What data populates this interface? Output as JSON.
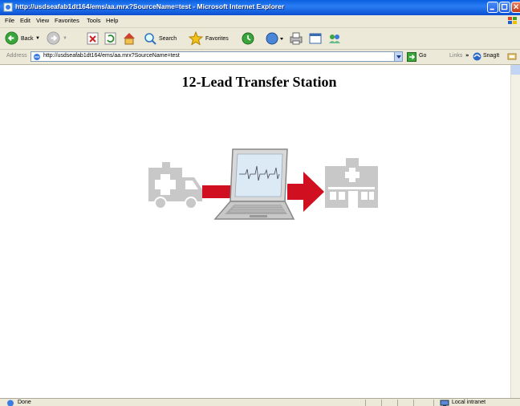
{
  "window": {
    "title": "http://usdseafab1dt164/ems/aa.mrx?SourceName=test - Microsoft Internet Explorer"
  },
  "menu": {
    "items": [
      "File",
      "Edit",
      "View",
      "Favorites",
      "Tools",
      "Help"
    ]
  },
  "toolbar": {
    "back_label": "Back",
    "search_label": "Search",
    "favorites_label": "Favorites"
  },
  "address": {
    "label": "Address",
    "url": "http://usdseafab1dt164/ems/aa.mrx?SourceName=test",
    "go_label": "Go",
    "links_label": "Links",
    "chevron": "»",
    "snagit_label": "SnagIt"
  },
  "page": {
    "title": "12-Lead Transfer Station"
  },
  "status": {
    "text": "Done",
    "zone": "Local intranet"
  },
  "colors": {
    "arrow_red": "#d01020",
    "icon_gray": "#c8c8c8",
    "titlebar_blue": "#0a5fe0",
    "chrome_beige": "#ece9d8"
  }
}
